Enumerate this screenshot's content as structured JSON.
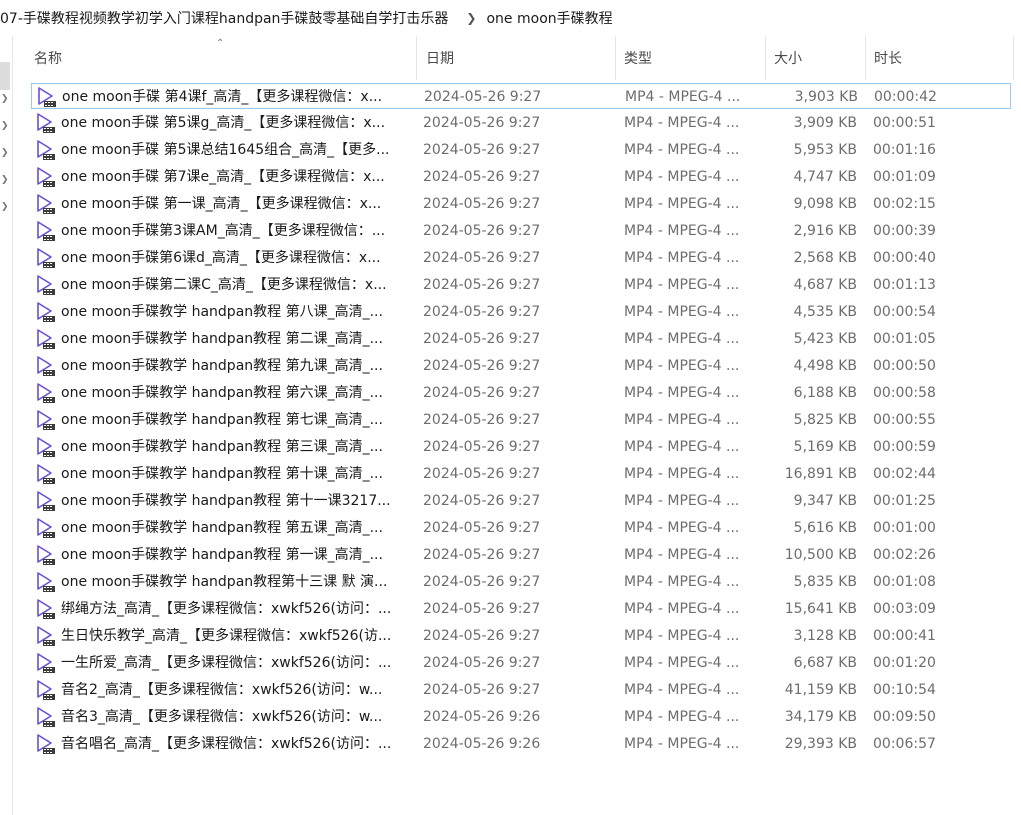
{
  "breadcrumb": {
    "parent": "07-手碟教程视频教学初学入门课程handpan手碟鼓零基础自学打击乐器",
    "current": "one moon手碟教程"
  },
  "columns": {
    "name": "名称",
    "date": "日期",
    "type": "类型",
    "size": "大小",
    "duration": "时长"
  },
  "files": [
    {
      "name": "one moon手碟 第4课f_高清_【更多课程微信：x...",
      "date": "2024-05-26 9:27",
      "type": "MP4 - MPEG-4 ...",
      "size": "3,903 KB",
      "duration": "00:00:42"
    },
    {
      "name": "one moon手碟 第5课g_高清_【更多课程微信：x...",
      "date": "2024-05-26 9:27",
      "type": "MP4 - MPEG-4 ...",
      "size": "3,909 KB",
      "duration": "00:00:51"
    },
    {
      "name": "one moon手碟 第5课总结1645组合_高清_【更多...",
      "date": "2024-05-26 9:27",
      "type": "MP4 - MPEG-4 ...",
      "size": "5,953 KB",
      "duration": "00:01:16"
    },
    {
      "name": "one moon手碟 第7课e_高清_【更多课程微信：x...",
      "date": "2024-05-26 9:27",
      "type": "MP4 - MPEG-4 ...",
      "size": "4,747 KB",
      "duration": "00:01:09"
    },
    {
      "name": "one moon手碟 第一课_高清_【更多课程微信：x...",
      "date": "2024-05-26 9:27",
      "type": "MP4 - MPEG-4 ...",
      "size": "9,098 KB",
      "duration": "00:02:15"
    },
    {
      "name": "one moon手碟第3课AM_高清_【更多课程微信：...",
      "date": "2024-05-26 9:27",
      "type": "MP4 - MPEG-4 ...",
      "size": "2,916 KB",
      "duration": "00:00:39"
    },
    {
      "name": "one moon手碟第6课d_高清_【更多课程微信：x...",
      "date": "2024-05-26 9:27",
      "type": "MP4 - MPEG-4 ...",
      "size": "2,568 KB",
      "duration": "00:00:40"
    },
    {
      "name": "one moon手碟第二课C_高清_【更多课程微信：x...",
      "date": "2024-05-26 9:27",
      "type": "MP4 - MPEG-4 ...",
      "size": "4,687 KB",
      "duration": "00:01:13"
    },
    {
      "name": "one moon手碟教学 handpan教程 第八课_高清_...",
      "date": "2024-05-26 9:27",
      "type": "MP4 - MPEG-4 ...",
      "size": "4,535 KB",
      "duration": "00:00:54"
    },
    {
      "name": "one moon手碟教学 handpan教程 第二课_高清_...",
      "date": "2024-05-26 9:27",
      "type": "MP4 - MPEG-4 ...",
      "size": "5,423 KB",
      "duration": "00:01:05"
    },
    {
      "name": "one moon手碟教学 handpan教程 第九课_高清_...",
      "date": "2024-05-26 9:27",
      "type": "MP4 - MPEG-4 ...",
      "size": "4,498 KB",
      "duration": "00:00:50"
    },
    {
      "name": "one moon手碟教学 handpan教程 第六课_高清_...",
      "date": "2024-05-26 9:27",
      "type": "MP4 - MPEG-4 ...",
      "size": "6,188 KB",
      "duration": "00:00:58"
    },
    {
      "name": "one moon手碟教学 handpan教程 第七课_高清_...",
      "date": "2024-05-26 9:27",
      "type": "MP4 - MPEG-4 ...",
      "size": "5,825 KB",
      "duration": "00:00:55"
    },
    {
      "name": "one moon手碟教学 handpan教程 第三课_高清_...",
      "date": "2024-05-26 9:27",
      "type": "MP4 - MPEG-4 ...",
      "size": "5,169 KB",
      "duration": "00:00:59"
    },
    {
      "name": "one moon手碟教学 handpan教程 第十课_高清_...",
      "date": "2024-05-26 9:27",
      "type": "MP4 - MPEG-4 ...",
      "size": "16,891 KB",
      "duration": "00:02:44"
    },
    {
      "name": "one moon手碟教学 handpan教程 第十一课3217...",
      "date": "2024-05-26 9:27",
      "type": "MP4 - MPEG-4 ...",
      "size": "9,347 KB",
      "duration": "00:01:25"
    },
    {
      "name": "one moon手碟教学 handpan教程 第五课_高清_...",
      "date": "2024-05-26 9:27",
      "type": "MP4 - MPEG-4 ...",
      "size": "5,616 KB",
      "duration": "00:01:00"
    },
    {
      "name": "one moon手碟教学 handpan教程 第一课_高清_...",
      "date": "2024-05-26 9:27",
      "type": "MP4 - MPEG-4 ...",
      "size": "10,500 KB",
      "duration": "00:02:26"
    },
    {
      "name": "one moon手碟教学 handpan教程第十三课 默 演...",
      "date": "2024-05-26 9:27",
      "type": "MP4 - MPEG-4 ...",
      "size": "5,835 KB",
      "duration": "00:01:08"
    },
    {
      "name": "绑绳方法_高清_【更多课程微信：xwkf526(访问：...",
      "date": "2024-05-26 9:27",
      "type": "MP4 - MPEG-4 ...",
      "size": "15,641 KB",
      "duration": "00:03:09"
    },
    {
      "name": "生日快乐教学_高清_【更多课程微信：xwkf526(访...",
      "date": "2024-05-26 9:27",
      "type": "MP4 - MPEG-4 ...",
      "size": "3,128 KB",
      "duration": "00:00:41"
    },
    {
      "name": "一生所爱_高清_【更多课程微信：xwkf526(访问：...",
      "date": "2024-05-26 9:27",
      "type": "MP4 - MPEG-4 ...",
      "size": "6,687 KB",
      "duration": "00:01:20"
    },
    {
      "name": "音名2_高清_【更多课程微信：xwkf526(访问：w...",
      "date": "2024-05-26 9:27",
      "type": "MP4 - MPEG-4 ...",
      "size": "41,159 KB",
      "duration": "00:10:54"
    },
    {
      "name": "音名3_高清_【更多课程微信：xwkf526(访问：w...",
      "date": "2024-05-26 9:26",
      "type": "MP4 - MPEG-4 ...",
      "size": "34,179 KB",
      "duration": "00:09:50"
    },
    {
      "name": "音名唱名_高清_【更多课程微信：xwkf526(访问：...",
      "date": "2024-05-26 9:26",
      "type": "MP4 - MPEG-4 ...",
      "size": "29,393 KB",
      "duration": "00:06:57"
    }
  ],
  "icons": {
    "file": "video-file-icon",
    "separator": "chevron-right-icon",
    "sort": "sort-ascending-icon",
    "tree": "chevron-right-icon"
  },
  "colors": {
    "icon_accent": "#6a4fd8",
    "focus_border": "#99c9ef",
    "secondary_text": "#6d6d6d"
  }
}
